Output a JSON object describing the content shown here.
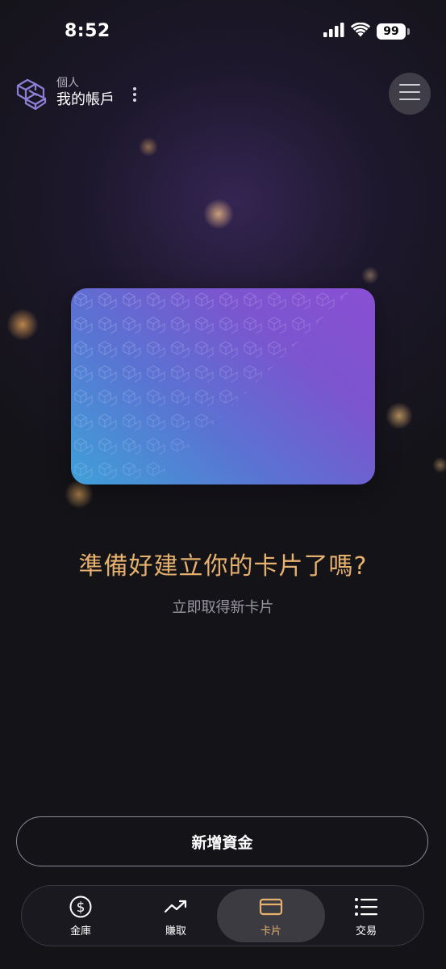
{
  "status_bar": {
    "time": "8:52",
    "battery": "99"
  },
  "header": {
    "account_type": "個人",
    "account_name": "我的帳戶"
  },
  "main": {
    "headline": "準備好建立你的卡片了嗎?",
    "subheadline": "立即取得新卡片"
  },
  "actions": {
    "add_funds": "新增資金"
  },
  "bottom_nav": {
    "items": [
      {
        "label": "金庫",
        "icon": "dollar-circle-icon"
      },
      {
        "label": "賺取",
        "icon": "trending-up-icon"
      },
      {
        "label": "卡片",
        "icon": "card-icon",
        "active": true
      },
      {
        "label": "交易",
        "icon": "list-icon"
      }
    ]
  },
  "colors": {
    "accent": "#e6b06e",
    "background": "#141318",
    "card_gradient_start": "#3fa0d8",
    "card_gradient_end": "#8a4fd3"
  }
}
